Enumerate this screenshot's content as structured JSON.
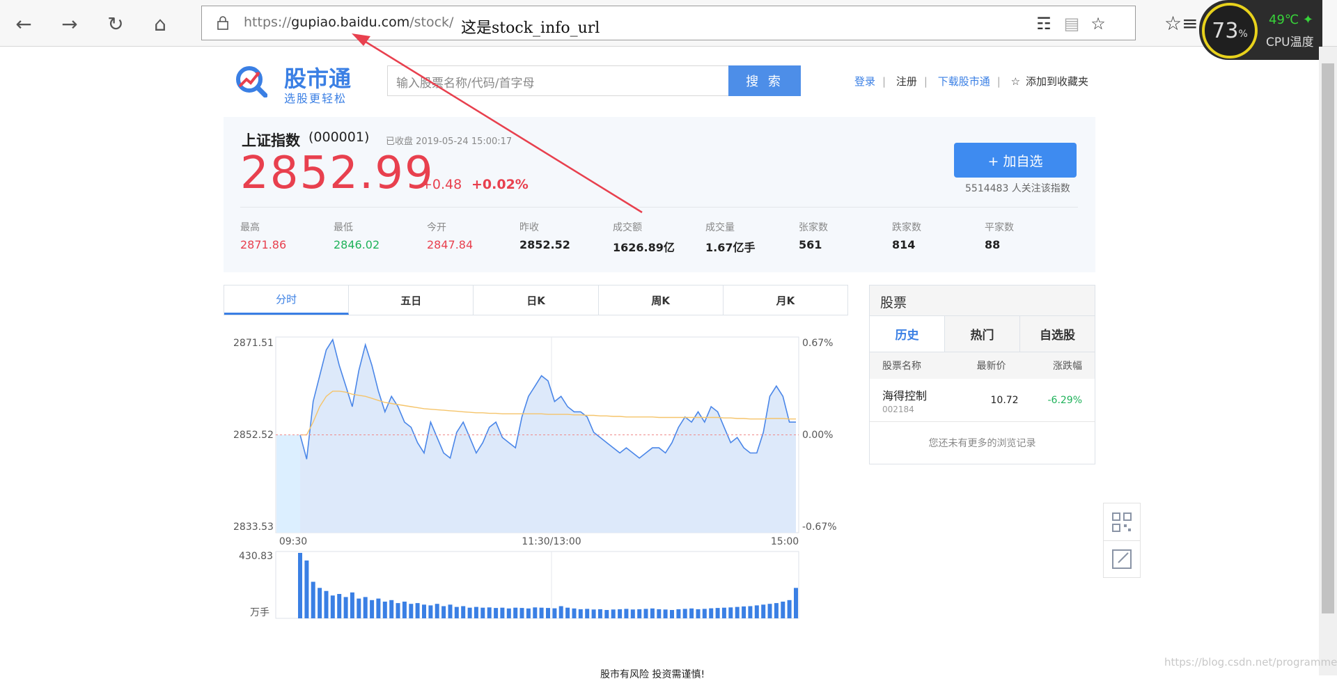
{
  "browser": {
    "url_prefix": "https://",
    "url_domain": "gupiao.baidu.com",
    "url_path": "/stock/",
    "annotation": "这是stock_info_url",
    "cpu_percent": "73",
    "cpu_percent_unit": "%",
    "cpu_temp": "49℃",
    "cpu_label": "CPU温度"
  },
  "header": {
    "logo_title": "股市通",
    "logo_subtitle": "选股更轻松",
    "search_placeholder": "输入股票名称/代码/首字母",
    "search_button": "搜 索",
    "links": {
      "login": "登录",
      "register": "注册",
      "download": "下载股市通",
      "bookmark": "添加到收藏夹"
    }
  },
  "quote": {
    "name": "上证指数",
    "code": "(000001)",
    "status": "已收盘 2019-05-24  15:00:17",
    "price": "2852.99",
    "change": "+0.48",
    "change_pct": "+0.02%",
    "add_button": "+ 加自选",
    "followers": "5514483 人关注该指数",
    "stats": [
      {
        "label": "最高",
        "value": "2871.86",
        "color": "red"
      },
      {
        "label": "最低",
        "value": "2846.02",
        "color": "green"
      },
      {
        "label": "今开",
        "value": "2847.84",
        "color": "red"
      },
      {
        "label": "昨收",
        "value": "2852.52",
        "color": "plain"
      },
      {
        "label": "成交额",
        "value": "1626.89亿",
        "color": "plain"
      },
      {
        "label": "成交量",
        "value": "1.67亿手",
        "color": "plain"
      },
      {
        "label": "张家数",
        "value": "561",
        "color": "plain"
      },
      {
        "label": "跌家数",
        "value": "814",
        "color": "plain"
      },
      {
        "label": "平家数",
        "value": "88",
        "color": "plain"
      }
    ]
  },
  "chart_tabs": [
    "分时",
    "五日",
    "日K",
    "周K",
    "月K"
  ],
  "chart_data": {
    "type": "area",
    "y_left_ticks": [
      "2871.51",
      "2852.52",
      "2833.53"
    ],
    "y_right_ticks": [
      "0.67%",
      "0.00%",
      "-0.67%"
    ],
    "x_ticks": [
      "09:30",
      "11:30/13:00",
      "15:00"
    ],
    "volume_max_label": "430.83",
    "volume_unit_label": "万手",
    "ylim": [
      2833.53,
      2871.51
    ],
    "baseline": 2852.52,
    "price": [
      2852.5,
      2847.8,
      2859,
      2864,
      2869,
      2871,
      2866,
      2862,
      2858,
      2865,
      2870,
      2866,
      2861,
      2857,
      2860,
      2858,
      2855,
      2854,
      2851,
      2849,
      2855,
      2852,
      2849,
      2848,
      2853,
      2855,
      2852,
      2849,
      2851,
      2854,
      2855,
      2852,
      2851,
      2850,
      2856,
      2860,
      2862,
      2864,
      2863,
      2859,
      2860,
      2858,
      2857,
      2857,
      2856,
      2853,
      2852,
      2851,
      2850,
      2849,
      2850,
      2849,
      2848,
      2849,
      2850,
      2850,
      2849,
      2851,
      2854,
      2856,
      2855,
      2857,
      2855,
      2858,
      2857,
      2854,
      2851,
      2852,
      2850,
      2849,
      2849,
      2853,
      2860,
      2862,
      2860,
      2855,
      2855
    ],
    "avg": [
      2852.5,
      2852.5,
      2855,
      2858,
      2860,
      2861,
      2861,
      2860.8,
      2860.4,
      2860.2,
      2860,
      2859.6,
      2859.2,
      2858.8,
      2858.6,
      2858.4,
      2858.2,
      2858,
      2857.8,
      2857.6,
      2857.5,
      2857.4,
      2857.3,
      2857.2,
      2857.1,
      2857,
      2856.9,
      2856.8,
      2856.8,
      2856.7,
      2856.7,
      2856.6,
      2856.6,
      2856.6,
      2856.6,
      2856.6,
      2856.6,
      2856.6,
      2856.5,
      2856.5,
      2856.5,
      2856.5,
      2856.4,
      2856.4,
      2856.3,
      2856.3,
      2856.2,
      2856.2,
      2856.1,
      2856.1,
      2856,
      2856,
      2856,
      2856,
      2856,
      2855.9,
      2855.9,
      2855.9,
      2855.9,
      2855.9,
      2855.9,
      2855.9,
      2855.9,
      2855.9,
      2855.9,
      2855.8,
      2855.8,
      2855.7,
      2855.7,
      2855.6,
      2855.6,
      2855.6,
      2855.7,
      2855.7,
      2855.7,
      2855.6,
      2855.6
    ],
    "volume": [
      430,
      380,
      240,
      200,
      180,
      150,
      160,
      140,
      170,
      130,
      140,
      120,
      130,
      110,
      120,
      100,
      110,
      95,
      100,
      90,
      85,
      95,
      80,
      90,
      75,
      80,
      70,
      75,
      70,
      72,
      68,
      70,
      65,
      70,
      68,
      65,
      72,
      70,
      68,
      66,
      80,
      70,
      65,
      60,
      62,
      58,
      60,
      55,
      58,
      60,
      62,
      58,
      60,
      62,
      65,
      60,
      58,
      55,
      60,
      62,
      65,
      60,
      62,
      66,
      68,
      70,
      72,
      75,
      78,
      80,
      85,
      90,
      95,
      100,
      110,
      120,
      200
    ]
  },
  "side_panel": {
    "title": "股票",
    "tabs": [
      "历史",
      "热门",
      "自选股"
    ],
    "columns": [
      "股票名称",
      "最新价",
      "涨跌幅"
    ],
    "row": {
      "name": "海得控制",
      "code": "002184",
      "price": "10.72",
      "change": "-6.29%"
    },
    "empty_text": "您还未有更多的浏览记录"
  },
  "footer": {
    "note": "股市有风险 投资需谨慎!"
  },
  "watermark": "https://blog.csdn.net/programmer",
  "colors": {
    "accent": "#3a7fe4",
    "up": "#e8404e",
    "down": "#1fb25a",
    "annotation_arrow": "#e8404e"
  }
}
